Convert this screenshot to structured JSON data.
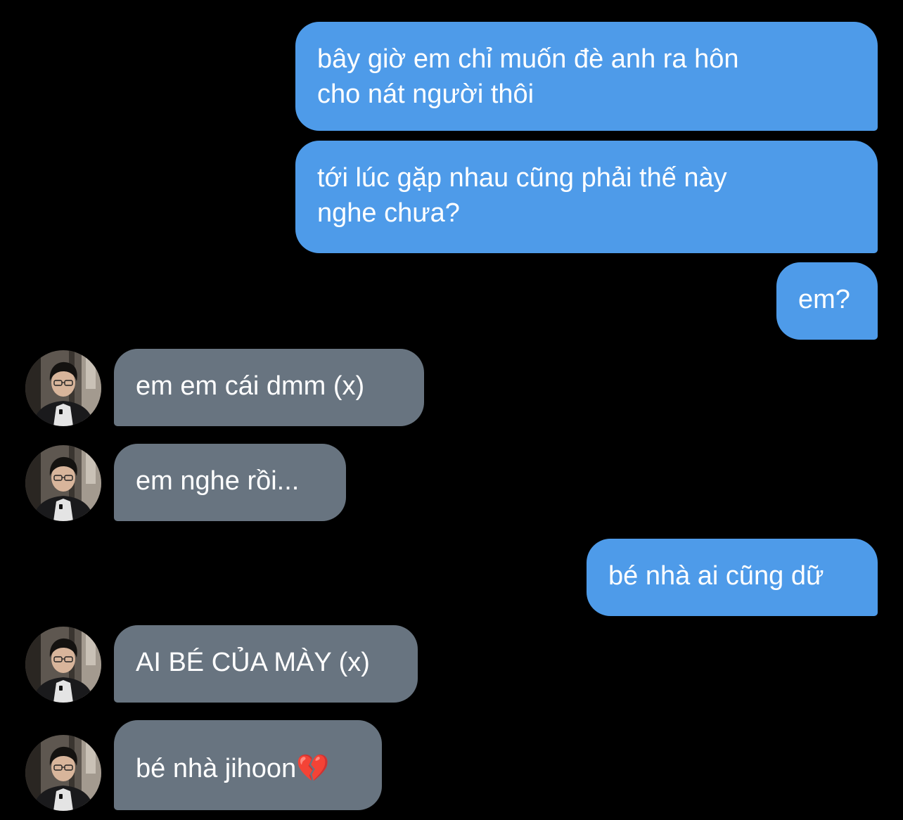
{
  "messages": [
    {
      "side": "sent",
      "text": "bây giờ em chỉ muốn đè anh ra hôn\ncho nát người thôi"
    },
    {
      "side": "sent",
      "text": "tới lúc gặp nhau cũng phải thế này\nnghe chưa?"
    },
    {
      "side": "sent",
      "text": "em?"
    },
    {
      "side": "received",
      "text": "em em cái dmm (x)"
    },
    {
      "side": "received",
      "text": "em nghe rồi..."
    },
    {
      "side": "sent",
      "text": "bé nhà ai cũng dữ"
    },
    {
      "side": "received",
      "text": "AI BÉ CỦA MÀY (x)"
    },
    {
      "side": "received",
      "text": "bé nhà jihoon💔"
    }
  ],
  "colors": {
    "background": "#000000",
    "sent_bubble": "#4e9be9",
    "received_bubble": "#687480",
    "text": "#ffffff"
  },
  "icons": {
    "avatar": "contact-avatar-photo"
  }
}
